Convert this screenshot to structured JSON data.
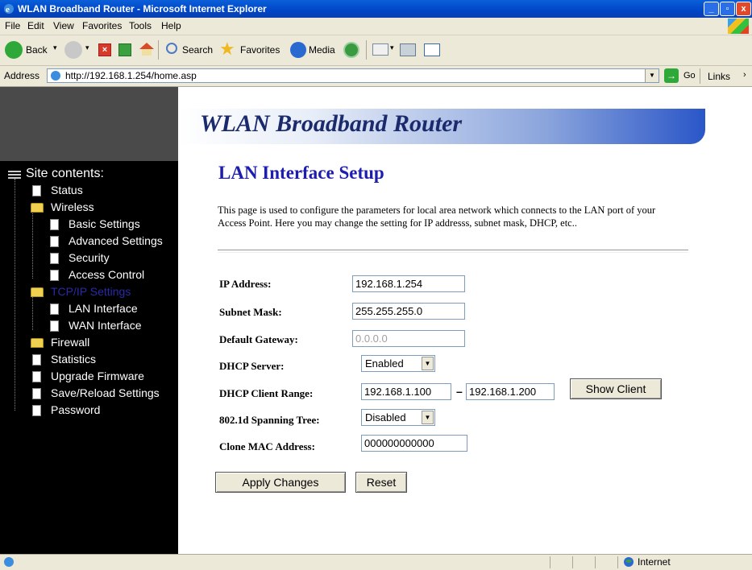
{
  "window": {
    "title": "WLAN Broadband Router - Microsoft Internet Explorer"
  },
  "menu": [
    "File",
    "Edit",
    "View",
    "Favorites",
    "Tools",
    "Help"
  ],
  "toolbar": {
    "back": "Back",
    "search": "Search",
    "favorites": "Favorites",
    "media": "Media"
  },
  "address": {
    "label": "Address",
    "url": "http://192.168.1.254/home.asp",
    "go": "Go",
    "links": "Links"
  },
  "banner": {
    "title": "WLAN Broadband Router"
  },
  "sidebar": {
    "heading": "Site contents:",
    "items": [
      {
        "label": "Status"
      },
      {
        "label": "Wireless"
      },
      {
        "label": "Basic Settings"
      },
      {
        "label": "Advanced Settings"
      },
      {
        "label": "Security"
      },
      {
        "label": "Access Control"
      },
      {
        "label": "TCP/IP Settings"
      },
      {
        "label": "LAN Interface"
      },
      {
        "label": "WAN Interface"
      },
      {
        "label": "Firewall"
      },
      {
        "label": "Statistics"
      },
      {
        "label": "Upgrade Firmware"
      },
      {
        "label": "Save/Reload Settings"
      },
      {
        "label": "Password"
      }
    ]
  },
  "main": {
    "title": "LAN Interface Setup",
    "description": "This page is used to configure the parameters for local area network which connects to the LAN port of your Access Point. Here you may change the setting for IP addresss, subnet mask, DHCP, etc..",
    "fields": {
      "ip_label": "IP Address:",
      "ip_value": "192.168.1.254",
      "mask_label": "Subnet Mask:",
      "mask_value": "255.255.255.0",
      "gw_label": "Default Gateway:",
      "gw_value": "0.0.0.0",
      "dhcp_label": "DHCP Server:",
      "dhcp_value": "Enabled",
      "range_label": "DHCP Client Range:",
      "range_start": "192.168.1.100",
      "range_sep": "–",
      "range_end": "192.168.1.200",
      "show_client": "Show Client",
      "stp_label": "802.1d Spanning Tree:",
      "stp_value": "Disabled",
      "mac_label": "Clone MAC Address:",
      "mac_value": "000000000000"
    },
    "apply": "Apply Changes",
    "reset": "Reset"
  },
  "status": {
    "zone": "Internet"
  }
}
